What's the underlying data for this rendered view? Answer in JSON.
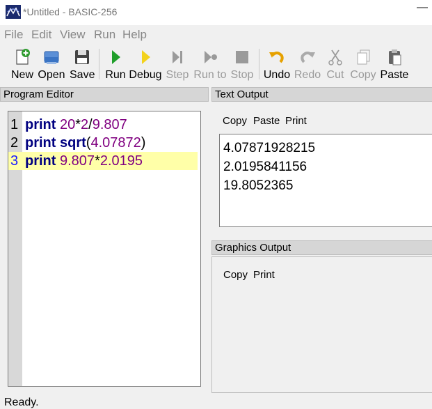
{
  "window": {
    "title": "*Untitled - BASIC-256",
    "app_icon": "basic256-logo-icon"
  },
  "menu": [
    "File",
    "Edit",
    "View",
    "Run",
    "Help"
  ],
  "toolbar": {
    "new": "New",
    "open": "Open",
    "save": "Save",
    "run": "Run",
    "debug": "Debug",
    "step": "Step",
    "run_to": "Run to",
    "stop": "Stop",
    "undo": "Undo",
    "redo": "Redo",
    "cut": "Cut",
    "copy": "Copy",
    "paste": "Paste"
  },
  "editor": {
    "header": "Program Editor",
    "lines": [
      {
        "num": "1",
        "kw": "print",
        "parts": [
          [
            "num",
            "20"
          ],
          [
            "op",
            "*"
          ],
          [
            "num",
            "2"
          ],
          [
            "op",
            "/"
          ],
          [
            "num",
            "9.807"
          ]
        ]
      },
      {
        "num": "2",
        "kw": "print",
        "parts": [
          [
            "kw",
            "sqrt"
          ],
          [
            "op",
            "("
          ],
          [
            "num",
            "4.07872"
          ],
          [
            "op",
            ")"
          ]
        ]
      },
      {
        "num": "3",
        "kw": "print",
        "parts": [
          [
            "num",
            "9.807"
          ],
          [
            "op",
            "*"
          ],
          [
            "num",
            "2.0195"
          ]
        ]
      }
    ],
    "current_line": 3
  },
  "text_output": {
    "header": "Text Output",
    "buttons": {
      "copy": "Copy",
      "paste": "Paste",
      "print": "Print"
    },
    "lines": [
      "4.07871928215",
      "2.0195841156",
      "19.8052365"
    ]
  },
  "graphics_output": {
    "header": "Graphics Output",
    "buttons": {
      "copy": "Copy",
      "print": "Print"
    }
  },
  "status": "Ready.",
  "colors": {
    "keyword": "#000080",
    "number": "#800080",
    "current_line_bg": "#ffffa8",
    "current_line_num": "#1a1aff"
  }
}
